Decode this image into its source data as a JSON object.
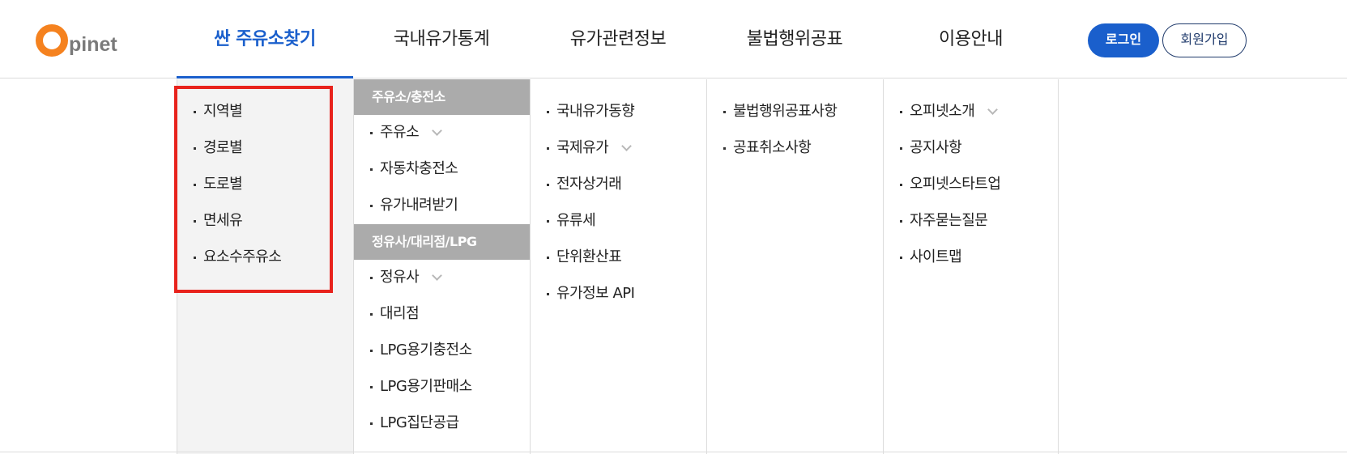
{
  "logo": {
    "letter": "O",
    "rest": "pinet"
  },
  "gnb": [
    {
      "label": "싼 주유소찾기",
      "active": true
    },
    {
      "label": "국내유가통계"
    },
    {
      "label": "유가관련정보"
    },
    {
      "label": "불법행위공표"
    },
    {
      "label": "이용안내"
    }
  ],
  "auth": {
    "login_label": "로그인",
    "join_label": "회원가입"
  },
  "menu": {
    "col1": {
      "items": [
        "지역별",
        "경로별",
        "도로별",
        "면세유",
        "요소수주유소"
      ]
    },
    "col2": {
      "sections": [
        {
          "title": "주유소/충전소",
          "items": [
            "주유소",
            "자동차충전소",
            "유가내려받기"
          ],
          "expandable": [
            true,
            false,
            false
          ]
        },
        {
          "title": "정유사/대리점/LPG",
          "items": [
            "정유사",
            "대리점",
            "LPG용기충전소",
            "LPG용기판매소",
            "LPG집단공급"
          ],
          "expandable": [
            true,
            false,
            false,
            false,
            false
          ]
        }
      ]
    },
    "col3": {
      "items": [
        "국내유가동향",
        "국제유가",
        "전자상거래",
        "유류세",
        "단위환산표",
        "유가정보 API"
      ],
      "expandable": [
        false,
        true,
        false,
        false,
        false,
        false
      ]
    },
    "col4": {
      "items": [
        "불법행위공표사항",
        "공표취소사항"
      ]
    },
    "col5": {
      "items": [
        "오피넷소개",
        "공지사항",
        "오피넷스타트업",
        "자주묻는질문",
        "사이트맵"
      ],
      "expandable": [
        true,
        false,
        false,
        false,
        false
      ]
    }
  },
  "colors": {
    "brand_orange": "#f5821f",
    "accent_blue": "#1a5fcc",
    "highlight_red": "#e8221c",
    "section_gray": "#ababab"
  }
}
